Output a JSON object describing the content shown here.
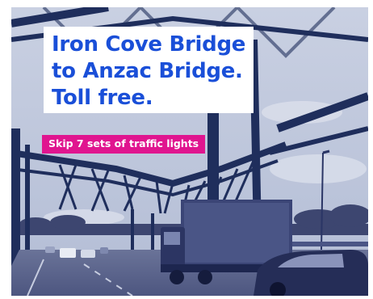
{
  "ad": {
    "headline_lines": [
      "Iron Cove Bridge",
      "to Anzac Bridge.",
      "Toll free."
    ],
    "tagline": "Skip 7 sets of traffic lights",
    "colors": {
      "headline": "#1a4fd8",
      "tagline_background": "#e0158f",
      "tagline_text": "#ffffff",
      "photo_tint": "#1f2e5c"
    },
    "photo": "duotone-photo-bridge-traffic"
  }
}
